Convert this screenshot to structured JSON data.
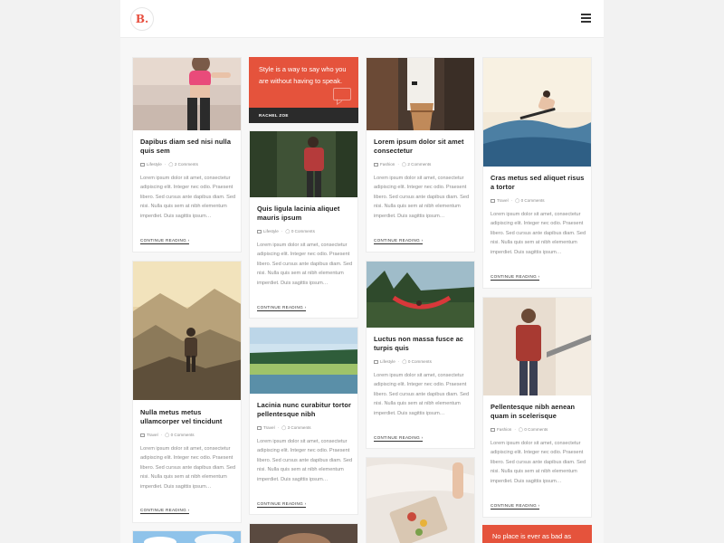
{
  "header": {
    "logo": "B.",
    "menu_icon": "hamburger-icon"
  },
  "accent_color": "#e5533c",
  "quote_top": {
    "text": "Style is a way to say who you are without having to speak.",
    "author": "RACHEL ZOE"
  },
  "quote_bottom": {
    "text": "No place is ever as bad as"
  },
  "posts": [
    {
      "title": "Dapibus diam sed nisi nulla quis sem",
      "category": "Lifestyle",
      "comments": "2 Comments",
      "excerpt": "Lorem ipsum dolor sit amet, consectetur adipiscing elit. Integer nec odio. Praesent libero. Sed cursus ante dapibus diam. Sed nisi. Nulla quis sem at nibh elementum imperdiet. Duis sagittis ipsum…",
      "more": "CONTINUE READING ›"
    },
    {
      "title": "Quis ligula lacinia aliquet mauris ipsum",
      "category": "Lifestyle",
      "comments": "0 Comments",
      "excerpt": "Lorem ipsum dolor sit amet, consectetur adipiscing elit. Integer nec odio. Praesent libero. Sed cursus ante dapibus diam. Sed nisi. Nulla quis sem at nibh elementum imperdiet. Duis sagittis ipsum…",
      "more": "CONTINUE READING ›"
    },
    {
      "title": "Lorem ipsum dolor sit amet consectetur",
      "category": "Fashion",
      "comments": "2 Comments",
      "excerpt": "Lorem ipsum dolor sit amet, consectetur adipiscing elit. Integer nec odio. Praesent libero. Sed cursus ante dapibus diam. Sed nisi. Nulla quis sem at nibh elementum imperdiet. Duis sagittis ipsum…",
      "more": "CONTINUE READING ›"
    },
    {
      "title": "Cras metus sed aliquet risus a tortor",
      "category": "Travel",
      "comments": "0 Comments",
      "excerpt": "Lorem ipsum dolor sit amet, consectetur adipiscing elit. Integer nec odio. Praesent libero. Sed cursus ante dapibus diam. Sed nisi. Nulla quis sem at nibh elementum imperdiet. Duis sagittis ipsum…",
      "more": "CONTINUE READING ›"
    },
    {
      "title": "Nulla metus metus ullamcorper vel tincidunt",
      "category": "Travel",
      "comments": "0 Comments",
      "excerpt": "Lorem ipsum dolor sit amet, consectetur adipiscing elit. Integer nec odio. Praesent libero. Sed cursus ante dapibus diam. Sed nisi. Nulla quis sem at nibh elementum imperdiet. Duis sagittis ipsum…",
      "more": "CONTINUE READING ›"
    },
    {
      "title": "Lacinia nunc curabitur tortor pellentesque nibh",
      "category": "Travel",
      "comments": "3 Comments",
      "excerpt": "Lorem ipsum dolor sit amet, consectetur adipiscing elit. Integer nec odio. Praesent libero. Sed cursus ante dapibus diam. Sed nisi. Nulla quis sem at nibh elementum imperdiet. Duis sagittis ipsum…",
      "more": "CONTINUE READING ›"
    },
    {
      "title": "Luctus non massa fusce ac turpis quis",
      "category": "Lifestyle",
      "comments": "0 Comments",
      "excerpt": "Lorem ipsum dolor sit amet, consectetur adipiscing elit. Integer nec odio. Praesent libero. Sed cursus ante dapibus diam. Sed nisi. Nulla quis sem at nibh elementum imperdiet. Duis sagittis ipsum…",
      "more": "CONTINUE READING ›"
    },
    {
      "title": "Pellentesque nibh aenean quam in scelerisque",
      "category": "Fashion",
      "comments": "0 Comments",
      "excerpt": "Lorem ipsum dolor sit amet, consectetur adipiscing elit. Integer nec odio. Praesent libero. Sed cursus ante dapibus diam. Sed nisi. Nulla quis sem at nibh elementum imperdiet. Duis sagittis ipsum…",
      "more": "CONTINUE READING ›"
    }
  ]
}
